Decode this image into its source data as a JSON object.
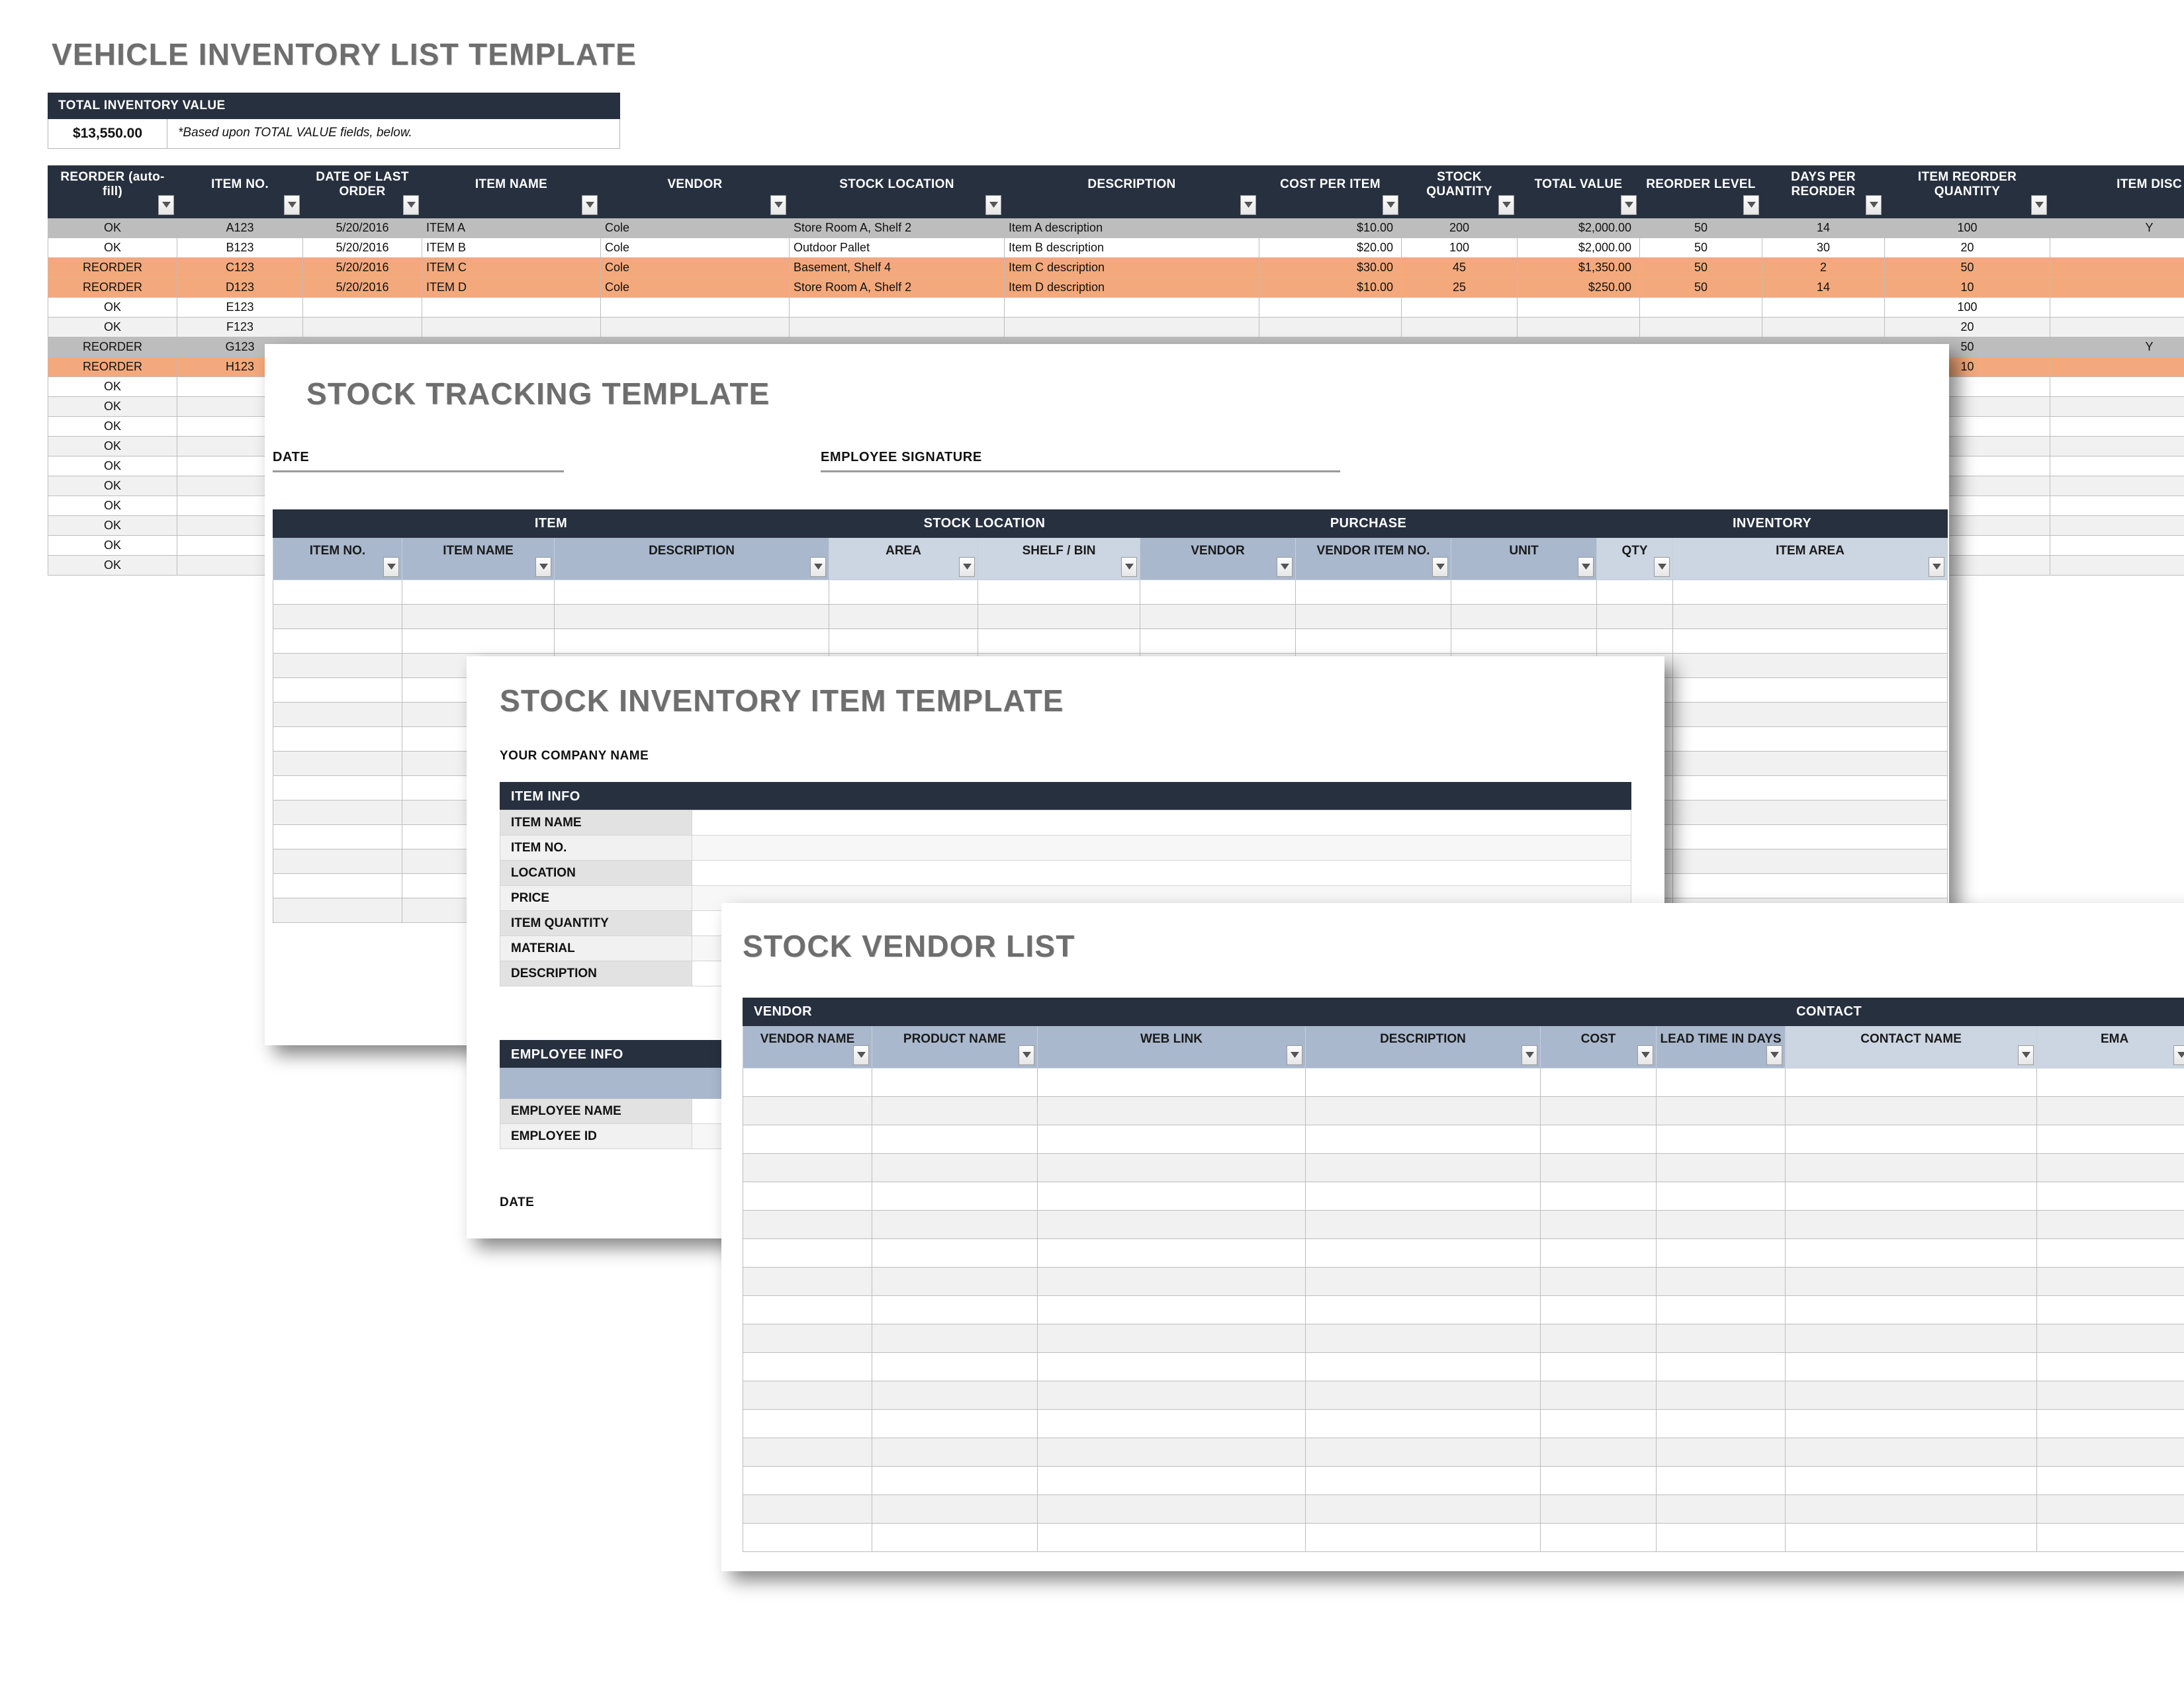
{
  "colors": {
    "dark_header": "#27303f",
    "blue_header": "#a9b8cd",
    "pale_blue_header": "#ccd6e2",
    "reorder_orange": "#f4a97c",
    "selected_grey": "#bdbdbd",
    "title_grey": "#6e6e6e"
  },
  "vehicle_inventory": {
    "title": "VEHICLE INVENTORY LIST TEMPLATE",
    "total_box": {
      "header": "TOTAL INVENTORY VALUE",
      "value": "$13,550.00",
      "note": "*Based upon TOTAL VALUE fields, below."
    },
    "columns": [
      "REORDER (auto-fill)",
      "ITEM NO.",
      "DATE OF LAST ORDER",
      "ITEM NAME",
      "VENDOR",
      "STOCK LOCATION",
      "DESCRIPTION",
      "COST PER ITEM",
      "STOCK QUANTITY",
      "TOTAL VALUE",
      "REORDER LEVEL",
      "DAYS PER REORDER",
      "ITEM REORDER QUANTITY",
      "ITEM DISC"
    ],
    "rows": [
      {
        "style": "grey",
        "cells": [
          "OK",
          "A123",
          "5/20/2016",
          "ITEM A",
          "Cole",
          "Store Room A, Shelf 2",
          "Item A description",
          "$10.00",
          "200",
          "$2,000.00",
          "50",
          "14",
          "100",
          "Y"
        ]
      },
      {
        "style": "white",
        "cells": [
          "OK",
          "B123",
          "5/20/2016",
          "ITEM B",
          "Cole",
          "Outdoor Pallet",
          "Item B description",
          "$20.00",
          "100",
          "$2,000.00",
          "50",
          "30",
          "20",
          ""
        ]
      },
      {
        "style": "orange",
        "cells": [
          "REORDER",
          "C123",
          "5/20/2016",
          "ITEM C",
          "Cole",
          "Basement, Shelf 4",
          "Item C description",
          "$30.00",
          "45",
          "$1,350.00",
          "50",
          "2",
          "50",
          ""
        ]
      },
      {
        "style": "orange",
        "cells": [
          "REORDER",
          "D123",
          "5/20/2016",
          "ITEM D",
          "Cole",
          "Store Room A, Shelf 2",
          "Item D description",
          "$10.00",
          "25",
          "$250.00",
          "50",
          "14",
          "10",
          ""
        ]
      },
      {
        "style": "white",
        "cells": [
          "OK",
          "E123",
          "",
          "",
          "",
          "",
          "",
          "",
          "",
          "",
          "",
          "",
          "100",
          ""
        ]
      },
      {
        "style": "alt",
        "cells": [
          "OK",
          "F123",
          "",
          "",
          "",
          "",
          "",
          "",
          "",
          "",
          "",
          "",
          "20",
          ""
        ]
      },
      {
        "style": "grey",
        "cells": [
          "REORDER",
          "G123",
          "",
          "",
          "",
          "",
          "",
          "",
          "",
          "",
          "",
          "",
          "50",
          "Y"
        ]
      },
      {
        "style": "orange",
        "cells": [
          "REORDER",
          "H123",
          "",
          "",
          "",
          "",
          "",
          "",
          "",
          "",
          "",
          "",
          "10",
          ""
        ]
      },
      {
        "style": "white",
        "cells": [
          "OK",
          "",
          "",
          "",
          "",
          "",
          "",
          "",
          "",
          "",
          "",
          "",
          "",
          ""
        ]
      },
      {
        "style": "alt",
        "cells": [
          "OK",
          "",
          "",
          "",
          "",
          "",
          "",
          "",
          "",
          "",
          "",
          "",
          "",
          ""
        ]
      },
      {
        "style": "white",
        "cells": [
          "OK",
          "",
          "",
          "",
          "",
          "",
          "",
          "",
          "",
          "",
          "",
          "",
          "",
          ""
        ]
      },
      {
        "style": "alt",
        "cells": [
          "OK",
          "",
          "",
          "",
          "",
          "",
          "",
          "",
          "",
          "",
          "",
          "",
          "",
          ""
        ]
      },
      {
        "style": "white",
        "cells": [
          "OK",
          "",
          "",
          "",
          "",
          "",
          "",
          "",
          "",
          "",
          "",
          "",
          "",
          ""
        ]
      },
      {
        "style": "alt",
        "cells": [
          "OK",
          "",
          "",
          "",
          "",
          "",
          "",
          "",
          "",
          "",
          "",
          "",
          "",
          ""
        ]
      },
      {
        "style": "white",
        "cells": [
          "OK",
          "",
          "",
          "",
          "",
          "",
          "",
          "",
          "",
          "",
          "",
          "",
          "",
          ""
        ]
      },
      {
        "style": "alt",
        "cells": [
          "OK",
          "",
          "",
          "",
          "",
          "",
          "",
          "",
          "",
          "",
          "",
          "",
          "",
          ""
        ]
      },
      {
        "style": "white",
        "cells": [
          "OK",
          "",
          "",
          "",
          "",
          "",
          "",
          "",
          "",
          "",
          "",
          "",
          "",
          ""
        ]
      },
      {
        "style": "alt",
        "cells": [
          "OK",
          "",
          "",
          "",
          "",
          "",
          "",
          "",
          "",
          "",
          "",
          "",
          "",
          ""
        ]
      }
    ]
  },
  "stock_tracking": {
    "title": "STOCK TRACKING TEMPLATE",
    "date_label": "DATE",
    "signature_label": "EMPLOYEE SIGNATURE",
    "groups": [
      "ITEM",
      "STOCK LOCATION",
      "PURCHASE",
      "INVENTORY"
    ],
    "columns": [
      "ITEM NO.",
      "ITEM NAME",
      "DESCRIPTION",
      "AREA",
      "SHELF / BIN",
      "VENDOR",
      "VENDOR ITEM NO.",
      "UNIT",
      "QTY",
      "ITEM AREA"
    ],
    "empty_row_count": 14
  },
  "stock_inventory_item": {
    "title": "STOCK INVENTORY ITEM TEMPLATE",
    "company_label": "YOUR COMPANY NAME",
    "item_info_header": "ITEM INFO",
    "item_fields": [
      "ITEM NAME",
      "ITEM NO.",
      "LOCATION",
      "PRICE",
      "ITEM QUANTITY",
      "MATERIAL",
      "DESCRIPTION"
    ],
    "employee_info_header": "EMPLOYEE INFO",
    "employee_fields": [
      "EMPLOYEE NAME",
      "EMPLOYEE ID"
    ],
    "date_label": "DATE"
  },
  "stock_vendor_list": {
    "title": "STOCK VENDOR LIST",
    "groups": [
      "VENDOR",
      "CONTACT"
    ],
    "columns": [
      "VENDOR NAME",
      "PRODUCT NAME",
      "WEB LINK",
      "DESCRIPTION",
      "COST",
      "LEAD TIME IN DAYS",
      "CONTACT NAME",
      "EMA"
    ],
    "empty_row_count": 17
  },
  "icons": {
    "filter_dropdown": "chevron-down-icon"
  }
}
